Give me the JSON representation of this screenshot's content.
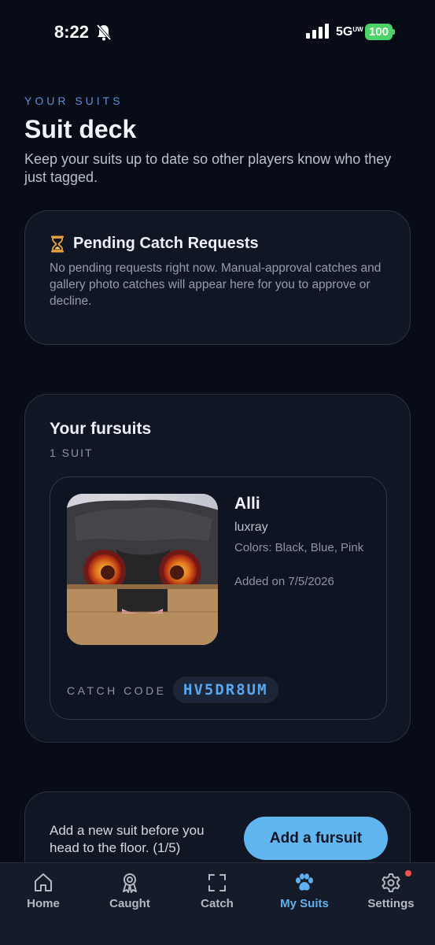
{
  "status_bar": {
    "time": "8:22",
    "network": "5G",
    "network_suffix": "UW",
    "battery": "100",
    "icons": [
      "bell-off-icon",
      "signal-icon",
      "battery-icon"
    ]
  },
  "header": {
    "eyebrow": "YOUR SUITS",
    "title": "Suit deck",
    "subtitle": "Keep your suits up to date so other players know who they just tagged."
  },
  "pending": {
    "icon": "hourglass-icon",
    "title": "Pending Catch Requests",
    "text": "No pending requests right now. Manual-approval catches and gallery photo catches will appear here for you to approve or decline."
  },
  "fursuits": {
    "title": "Your fursuits",
    "count": "1 SUIT",
    "items": [
      {
        "name": "Alli",
        "species": "luxray",
        "colors": "Colors: Black, Blue, Pink",
        "added": "Added on 7/5/2026",
        "catch_code_label": "CATCH CODE",
        "catch_code": "HV5DR8UM"
      }
    ]
  },
  "add": {
    "text": "Add a new suit before you head to the floor. (1/5)",
    "button": "Add a fursuit"
  },
  "tabs": [
    {
      "label": "Home",
      "icon": "home-icon",
      "active": false
    },
    {
      "label": "Caught",
      "icon": "award-icon",
      "active": false
    },
    {
      "label": "Catch",
      "icon": "scan-icon",
      "active": false
    },
    {
      "label": "My Suits",
      "icon": "paw-icon",
      "active": true
    },
    {
      "label": "Settings",
      "icon": "gear-icon",
      "active": false,
      "badge": true
    }
  ],
  "colors": {
    "background": "#080c16",
    "card": "#111624",
    "accent": "#62b6ef",
    "active_tab": "#5fb1f2",
    "catch_code": "#56a8ee",
    "battery": "#4bd36a",
    "badge": "#f0544a"
  }
}
